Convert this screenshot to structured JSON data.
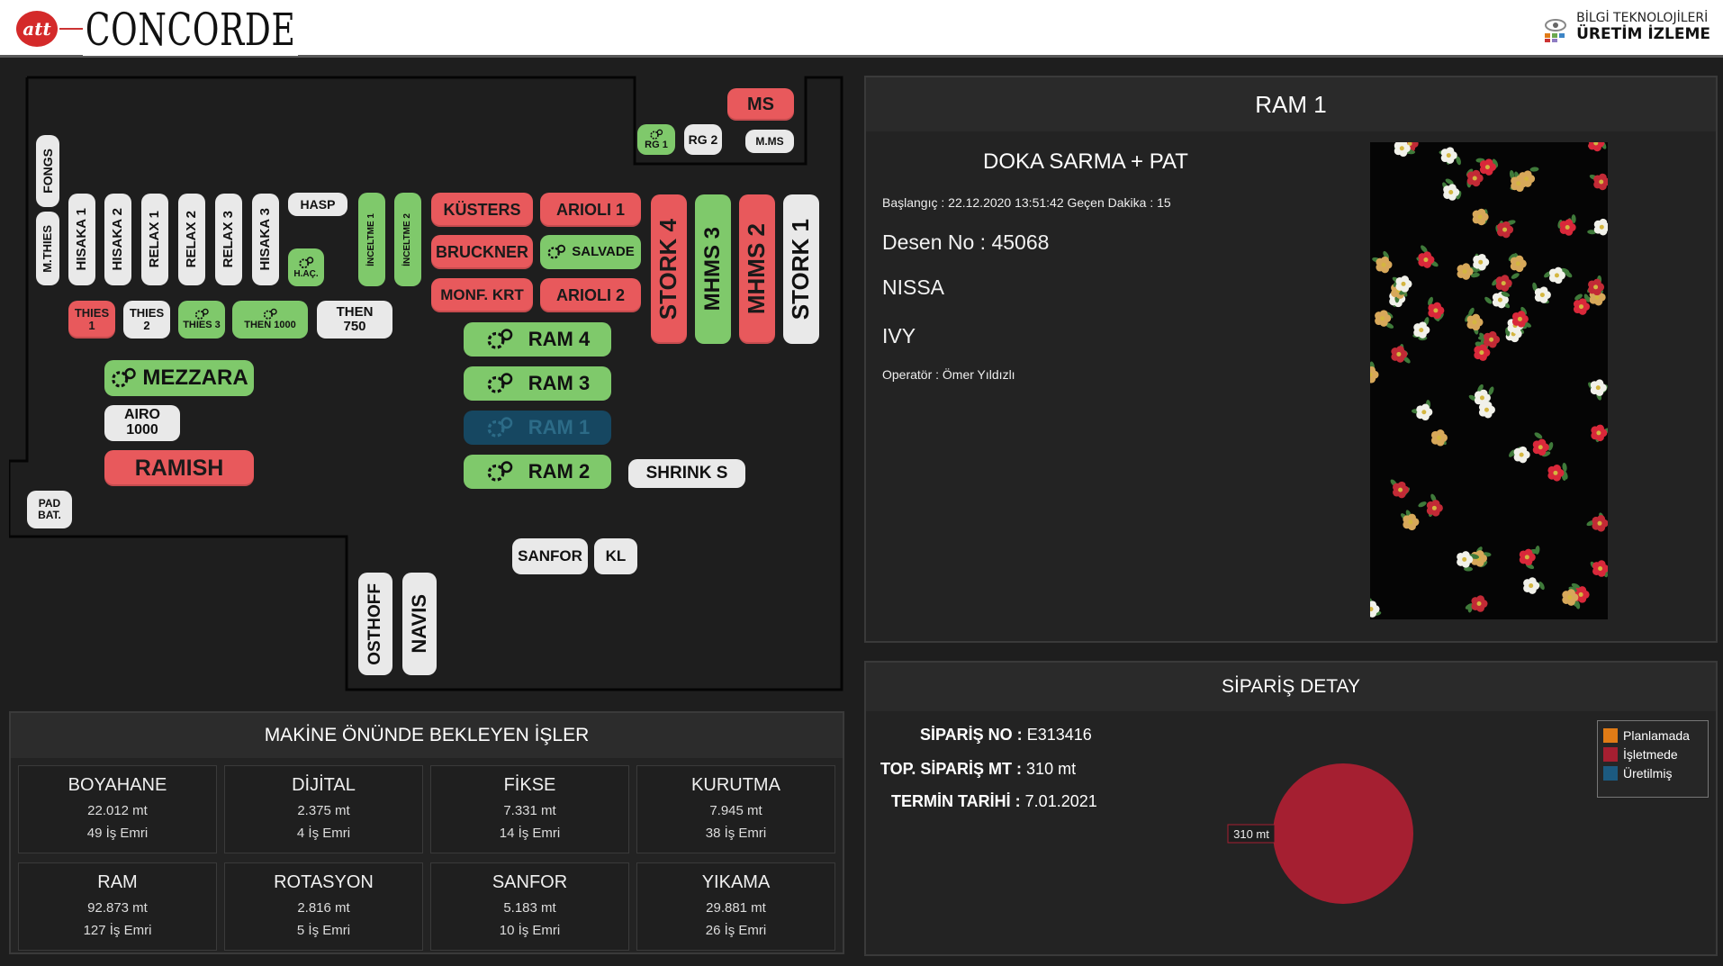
{
  "header": {
    "logo_att": "att",
    "logo_text": "CONCORDE",
    "brand_line1": "BİLGİ TEKNOLOJİLERİ",
    "brand_line2": "ÜRETİM İZLEME"
  },
  "colors": {
    "red": "#e8595c",
    "green": "#7fc96b",
    "white": "#e9e9e9",
    "selected": "#164761",
    "planlamada": "#e07b16",
    "isletmede": "#a51f31",
    "uretilmis": "#1c5a80"
  },
  "machines": {
    "fongs": "FONGS",
    "mthies": "M.THIES",
    "hisaka1": "HISAKA 1",
    "hisaka2": "HISAKA 2",
    "relax1": "RELAX 1",
    "relax2": "RELAX 2",
    "relax3": "RELAX 3",
    "hisaka3": "HISAKA 3",
    "hasp": "HASP",
    "hac": "H.AÇ.",
    "inceltme1": "İNCELTME 1",
    "inceltme2": "İNCELTME 2",
    "kusters": "KÜSTERS",
    "arioli1": "ARIOLI 1",
    "bruckner": "BRUCKNER",
    "salvade": "SALVADE",
    "monfkrt": "MONF. KRT",
    "arioli2": "ARIOLI 2",
    "stork4": "STORK 4",
    "mhms3": "MHMS 3",
    "mhms2": "MHMS 2",
    "stork1": "STORK 1",
    "ms": "MS",
    "rg1": "RG 1",
    "rg2": "RG 2",
    "mms": "M.MS",
    "thies1_a": "THIES",
    "thies1_b": "1",
    "thies2_a": "THIES",
    "thies2_b": "2",
    "thies3": "THIES 3",
    "then1000": "THEN 1000",
    "then750_a": "THEN",
    "then750_b": "750",
    "ram4": "RAM 4",
    "ram3": "RAM 3",
    "ram1": "RAM 1",
    "ram2": "RAM 2",
    "shrinks": "SHRINK S",
    "mezzara": "MEZZARA",
    "airo_a": "AIRO",
    "airo_b": "1000",
    "ramish": "RAMISH",
    "padbat_a": "PAD",
    "padbat_b": "BAT.",
    "sanfor": "SANFOR",
    "kl": "KL",
    "osthoff": "OSTHOFF",
    "navis": "NAVIS"
  },
  "ram_panel": {
    "title": "RAM 1",
    "process": "DOKA SARMA + PAT",
    "start_line": "Başlangıç : 22.12.2020 13:51:42 Geçen Dakika : 15",
    "desen": "Desen No : 45068",
    "line2": "NISSA",
    "line3": "IVY",
    "operator": "Operatör : Ömer Yıldızlı"
  },
  "jobs": {
    "title": "MAKİNE ÖNÜNDE BEKLEYEN İŞLER",
    "items": [
      {
        "name": "BOYAHANE",
        "mt": "22.012 mt",
        "emir": "49 İş Emri"
      },
      {
        "name": "DİJİTAL",
        "mt": "2.375 mt",
        "emir": "4 İş Emri"
      },
      {
        "name": "FİKSE",
        "mt": "7.331 mt",
        "emir": "14 İş Emri"
      },
      {
        "name": "KURUTMA",
        "mt": "7.945 mt",
        "emir": "38 İş Emri"
      },
      {
        "name": "RAM",
        "mt": "92.873 mt",
        "emir": "127 İş Emri"
      },
      {
        "name": "ROTASYON",
        "mt": "2.816 mt",
        "emir": "5 İş Emri"
      },
      {
        "name": "SANFOR",
        "mt": "5.183 mt",
        "emir": "10 İş Emri"
      },
      {
        "name": "YIKAMA",
        "mt": "29.881 mt",
        "emir": "26 İş Emri"
      }
    ]
  },
  "order": {
    "title": "SİPARİŞ DETAY",
    "no_label": "SİPARİŞ NO :",
    "no_value": "E313416",
    "mt_label": "TOP. SİPARİŞ MT :",
    "mt_value": "310 mt",
    "date_label": "TERMİN TARİHİ :",
    "date_value": "7.01.2021",
    "legend": [
      "Planlamada",
      "İşletmede",
      "Üretilmiş"
    ],
    "pie_label": "310 mt"
  },
  "chart_data": {
    "type": "pie",
    "categories": [
      "Planlamada",
      "İşletmede",
      "Üretilmiş"
    ],
    "values": [
      0,
      310,
      0
    ],
    "legend_position": "top-right"
  }
}
